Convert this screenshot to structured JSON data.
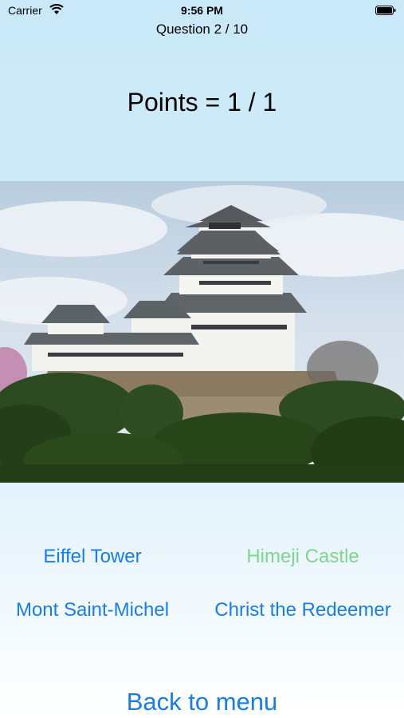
{
  "status_bar": {
    "carrier": "Carrier",
    "time": "9:56 PM"
  },
  "quiz": {
    "question_counter": "Question 2 / 10",
    "points": "Points = 1 / 1",
    "photo_subject": "castle-photo",
    "answers": [
      {
        "label": "Eiffel Tower",
        "state": "default"
      },
      {
        "label": "Himeji Castle",
        "state": "correct"
      },
      {
        "label": "Mont Saint-Michel",
        "state": "default"
      },
      {
        "label": "Christ the Redeemer",
        "state": "default"
      }
    ],
    "back_label": "Back to menu"
  },
  "colors": {
    "accent": "#1a7de0",
    "correct": "#7dd68e",
    "background_top": "#c9e9f8"
  }
}
